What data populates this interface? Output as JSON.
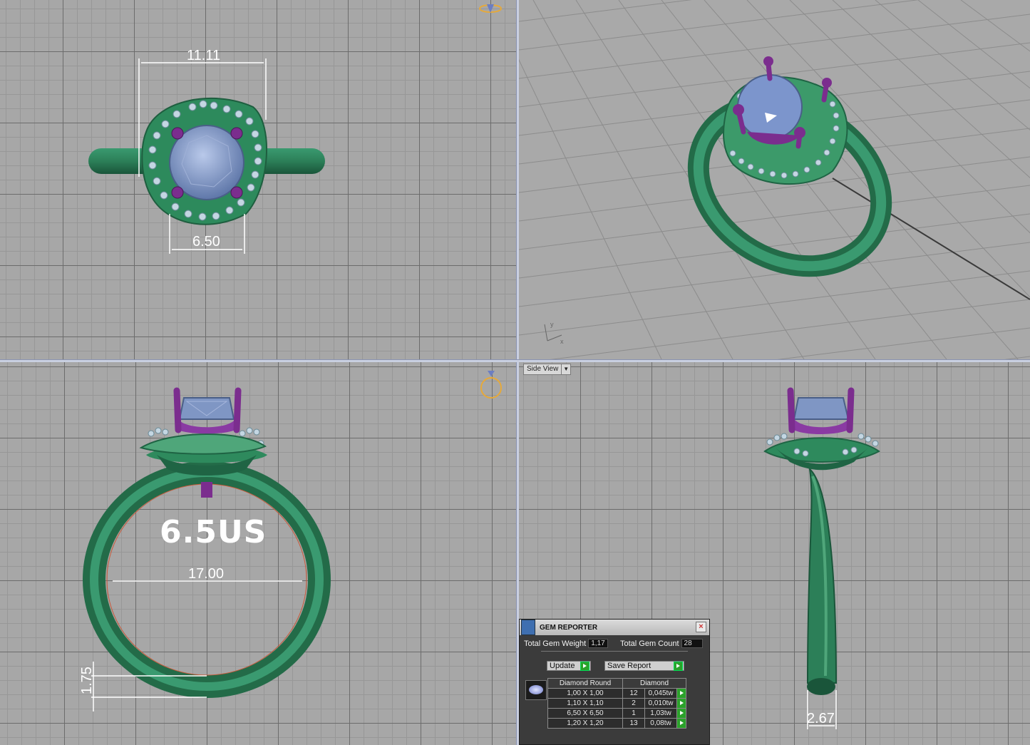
{
  "dimensions": {
    "top_width": "11.11",
    "top_gem": "6.50",
    "inner_diameter": "17.00",
    "band_thickness": "1.75",
    "band_width": "2.67"
  },
  "ring_size_label": "6.5US",
  "side_view": {
    "label": "Side View"
  },
  "gem_reporter": {
    "title": "GEM REPORTER",
    "close": "×",
    "weight_label": "Total Gem Weight",
    "weight_value": "1,17",
    "count_label": "Total Gem Count",
    "count_value": "28",
    "update_label": "Update",
    "save_label": "Save Report",
    "col_shape": "Diamond Round",
    "col_material": "Diamond",
    "rows": [
      {
        "size": "1,00 X 1,00",
        "qty": "12",
        "tw": "0,045tw"
      },
      {
        "size": "1,10 X 1,10",
        "qty": "2",
        "tw": "0,010tw"
      },
      {
        "size": "6,50 X 6,50",
        "qty": "1",
        "tw": "1,03tw"
      },
      {
        "size": "1,20 X 1,20",
        "qty": "13",
        "tw": "0,08tw"
      }
    ]
  },
  "colors": {
    "metal": "#2f8a5e",
    "prong": "#8a3aa3",
    "gem": "#7f96c4",
    "accent": "#e6a93a"
  }
}
